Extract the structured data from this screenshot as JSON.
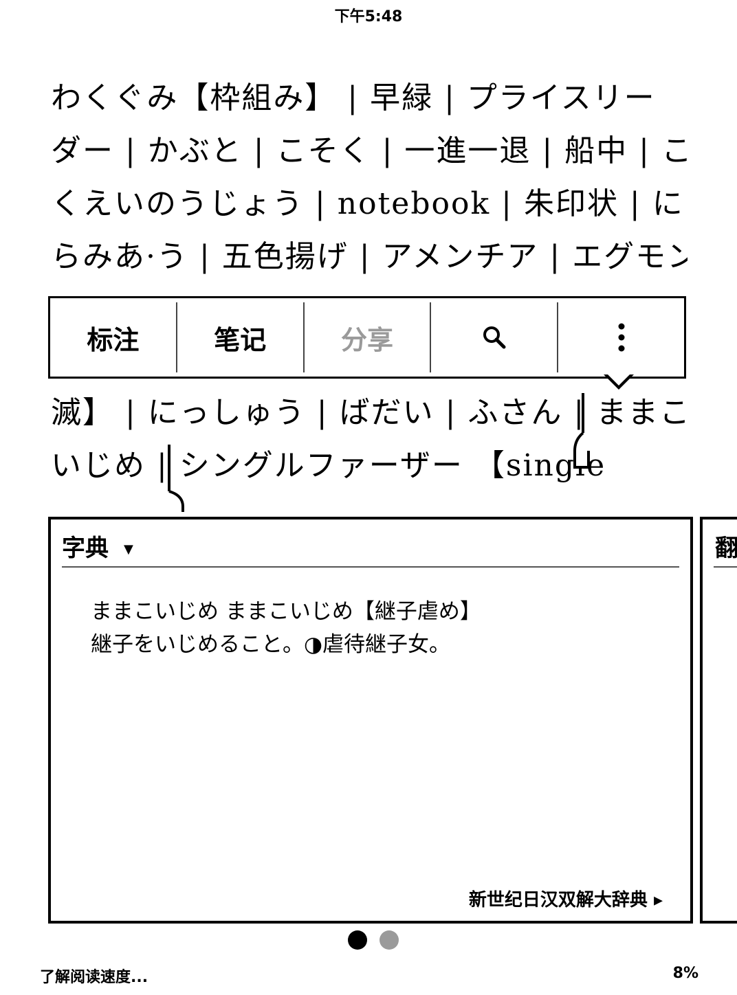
{
  "status": {
    "time": "下午5:48"
  },
  "reading": {
    "lines_top": [
      "わくぐみ【枠組み】 | 早緑 | プライスリー",
      "ダー | かぶと | こそく | 一進一退 | 船中 | こ",
      "くえいのうじょう | notebook | 朱印状 | に",
      "らみあ·う | 五色揚げ | アメンチア | エグモン"
    ],
    "lines_bottom": [
      "滅】 | にっしゅう | ばだい | ふさん | ままこ",
      "いじめ | シングルファーザー 【single"
    ]
  },
  "toolbar": {
    "highlight": "标注",
    "note": "笔记",
    "share": "分享",
    "search_icon": "search-icon",
    "more_icon": "more-vertical-icon"
  },
  "dictionary": {
    "title": "字典",
    "dropdown_arrow": "▼",
    "entry_line1": "ままこいじめ ままこいじめ【継子虐め】",
    "entry_line2": "継子をいじめること。◑虐待継子女。",
    "source": "新世纪日汉双解大辞典 ▸"
  },
  "side_panel": {
    "title": "翻"
  },
  "pager": {
    "active": 0,
    "count": 2
  },
  "footer": {
    "left": "了解阅读速度...",
    "right": "8%"
  }
}
